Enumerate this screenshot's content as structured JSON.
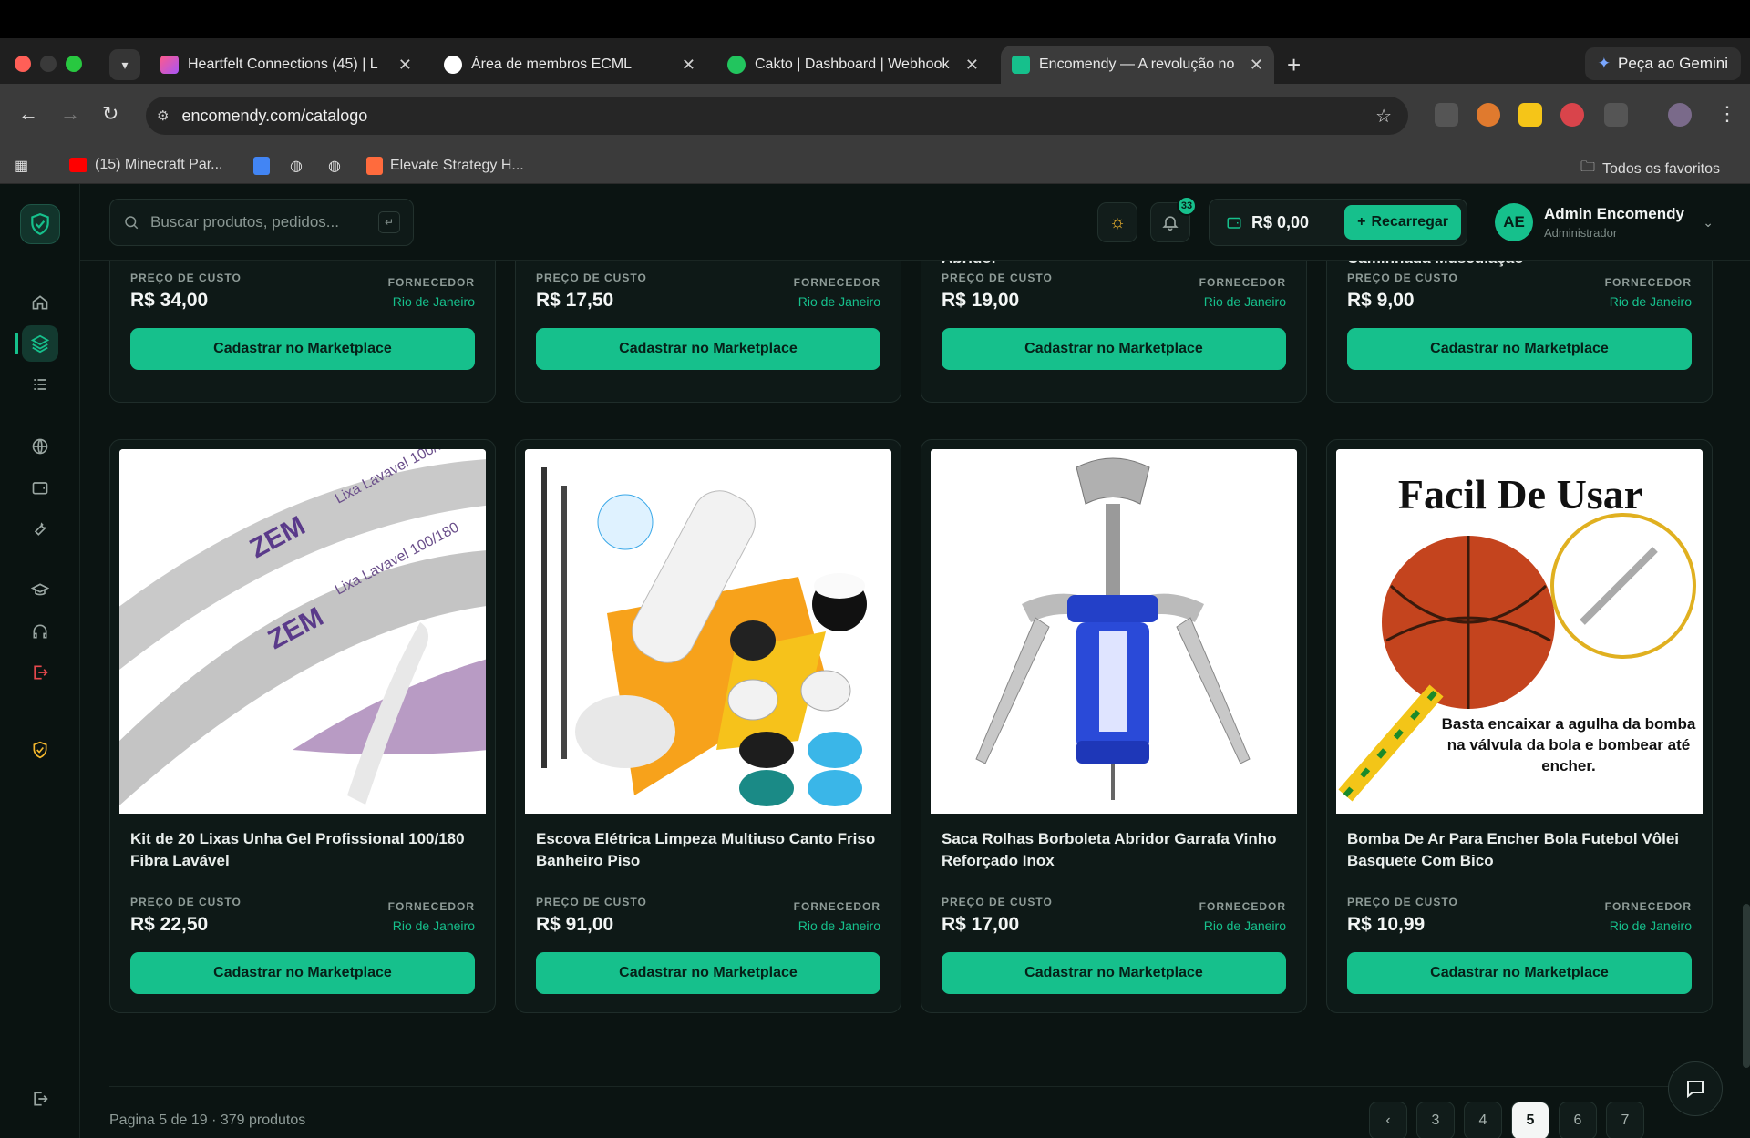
{
  "browser": {
    "tabs": [
      {
        "title": "Heartfelt Connections (45) | L",
        "fav": "#ff5a8a"
      },
      {
        "title": "Área de membros ECML",
        "fav": "#ffffff"
      },
      {
        "title": "Cakto | Dashboard | Webhook",
        "fav": "#22c55e"
      },
      {
        "title": "Encomendy — A revolução no",
        "fav": "#16c08c"
      }
    ],
    "gemini_label": "Peça ao Gemini",
    "url": "encomendy.com/catalogo",
    "bookmarks": [
      "(15) Minecraft Par...",
      "Elevate Strategy H..."
    ],
    "all_bookmarks": "Todos os favoritos"
  },
  "app": {
    "search_placeholder": "Buscar produtos, pedidos...",
    "notifications": "33",
    "balance": "R$ 0,00",
    "recharge_label": "Recarregar",
    "user": {
      "initials": "AE",
      "name": "Admin Encomendy",
      "role": "Administrador"
    }
  },
  "labels": {
    "cost": "PREÇO DE CUSTO",
    "supplier": "FORNECEDOR",
    "cta": "Cadastrar no Marketplace"
  },
  "row1": [
    {
      "name": "",
      "price": "R$ 34,00",
      "location": "Rio de Janeiro"
    },
    {
      "name": "",
      "price": "R$ 17,50",
      "location": "Rio de Janeiro"
    },
    {
      "name": "Abridor",
      "price": "R$ 19,00",
      "location": "Rio de Janeiro"
    },
    {
      "name": "Caminhada Musculação",
      "price": "R$ 9,00",
      "location": "Rio de Janeiro"
    }
  ],
  "row2": [
    {
      "name": "Kit de 20 Lixas Unha Gel Profissional 100/180 Fibra Lavável",
      "price": "R$ 22,50",
      "location": "Rio de Janeiro",
      "image_text": [
        "Lixa Lavavel 100/180",
        "ZEM"
      ]
    },
    {
      "name": "Escova Elétrica Limpeza Multiuso Canto Friso Banheiro Piso",
      "price": "R$ 91,00",
      "location": "Rio de Janeiro"
    },
    {
      "name": "Saca Rolhas Borboleta Abridor Garrafa Vinho Reforçado Inox",
      "price": "R$ 17,00",
      "location": "Rio de Janeiro"
    },
    {
      "name": "Bomba De Ar Para Encher Bola Futebol Vôlei Basquete Com Bico",
      "price": "R$ 10,99",
      "location": "Rio de Janeiro",
      "image_text": [
        "Facil De Usar",
        "Basta encaixar a agulha da bomba na válvula da bola e bombear até encher."
      ]
    }
  ],
  "footer": {
    "summary": "Pagina 5 de 19 · 379 produtos",
    "pages": [
      "3",
      "4",
      "5",
      "6",
      "7"
    ],
    "current_page": "5"
  },
  "colors": {
    "accent": "#16c08c",
    "background": "#0b1412"
  }
}
